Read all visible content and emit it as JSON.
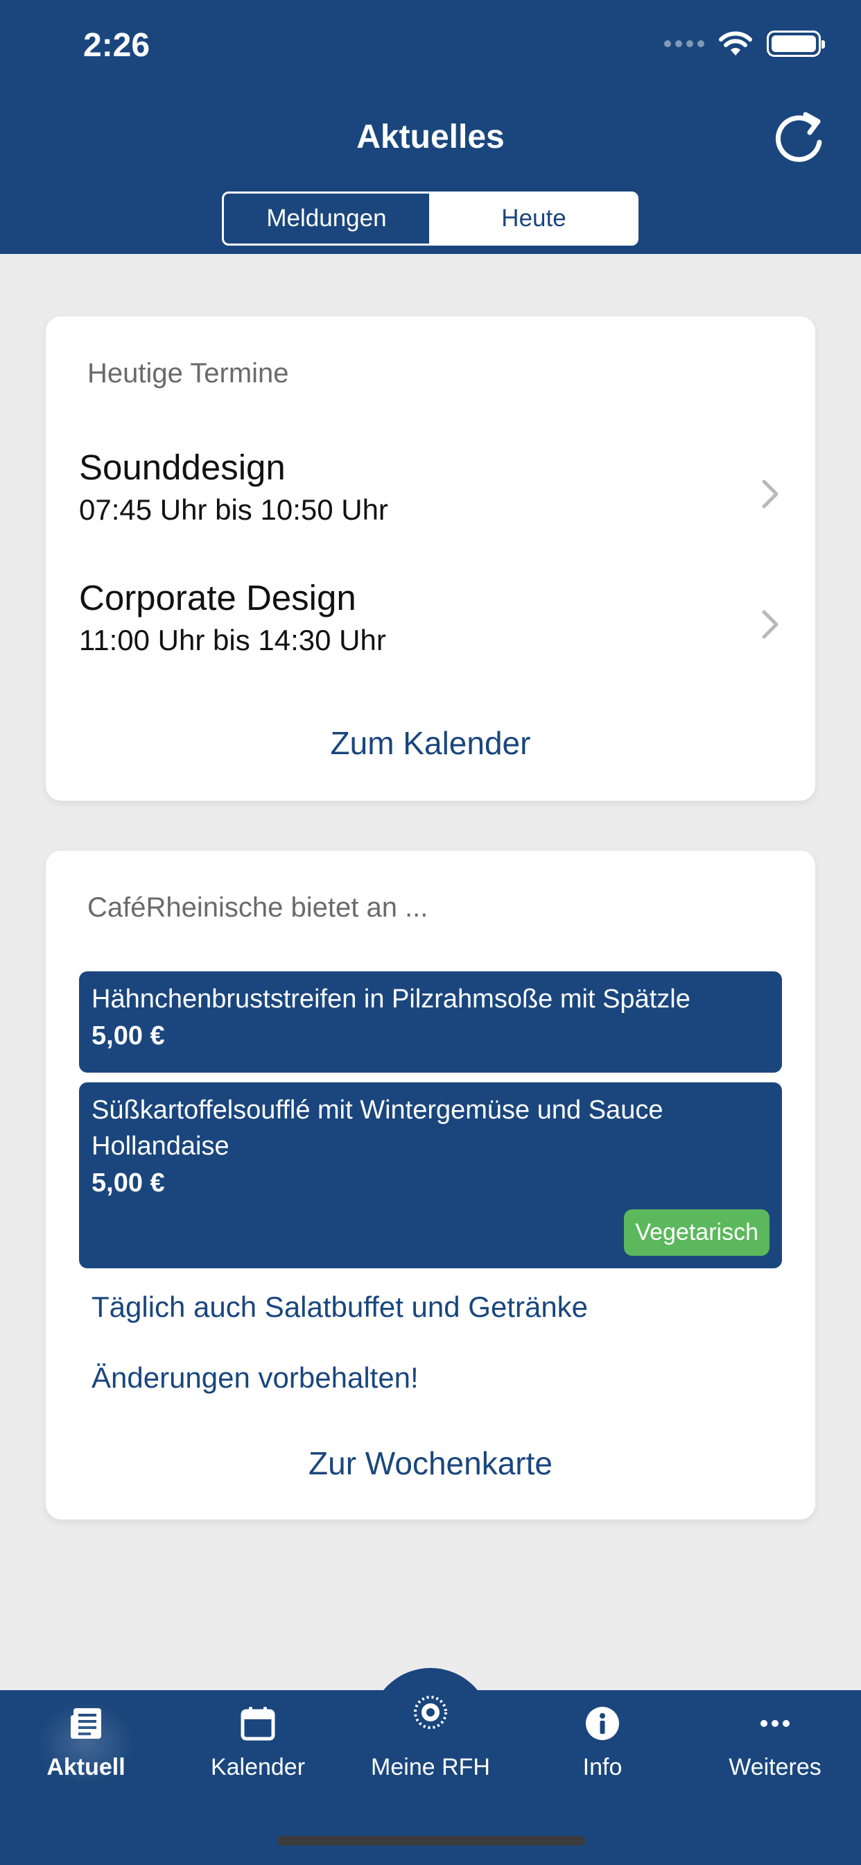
{
  "status_bar": {
    "time": "2:26"
  },
  "nav": {
    "title": "Aktuelles",
    "segments": [
      {
        "label": "Meldungen",
        "selected": false
      },
      {
        "label": "Heute",
        "selected": true
      }
    ]
  },
  "appointments": {
    "heading": "Heutige Termine",
    "items": [
      {
        "title": "Sounddesign",
        "time": "07:45 Uhr bis 10:50 Uhr"
      },
      {
        "title": "Corporate Design",
        "time": "11:00 Uhr bis 14:30 Uhr"
      }
    ],
    "link": "Zum Kalender"
  },
  "cafe": {
    "heading": "CaféRheinische bietet an ...",
    "items": [
      {
        "name": "Hähnchenbruststreifen in Pilzrahmsoße mit Spätzle",
        "price": "5,00 €"
      },
      {
        "name": "Süßkartoffelsoufflé mit Wintergemüse und Sauce Hollandaise",
        "price": "5,00 €",
        "badge": "Vegetarisch"
      }
    ],
    "notes": [
      "Täglich auch Salatbuffet und Getränke",
      "Änderungen vorbehalten!"
    ],
    "link": "Zur Wochenkarte"
  },
  "tabbar": {
    "tabs": [
      {
        "label": "Aktuell",
        "icon": "newspaper-icon",
        "active": true
      },
      {
        "label": "Kalender",
        "icon": "calendar-icon",
        "active": false
      },
      {
        "label": "Meine RFH",
        "icon": "rfh-seal-icon",
        "active": false
      },
      {
        "label": "Info",
        "icon": "info-icon",
        "active": false
      },
      {
        "label": "Weiteres",
        "icon": "more-icon",
        "active": false
      }
    ]
  },
  "colors": {
    "primary": "#1a467d",
    "background": "#ececec",
    "vegetarian_badge": "#5cb85c"
  }
}
